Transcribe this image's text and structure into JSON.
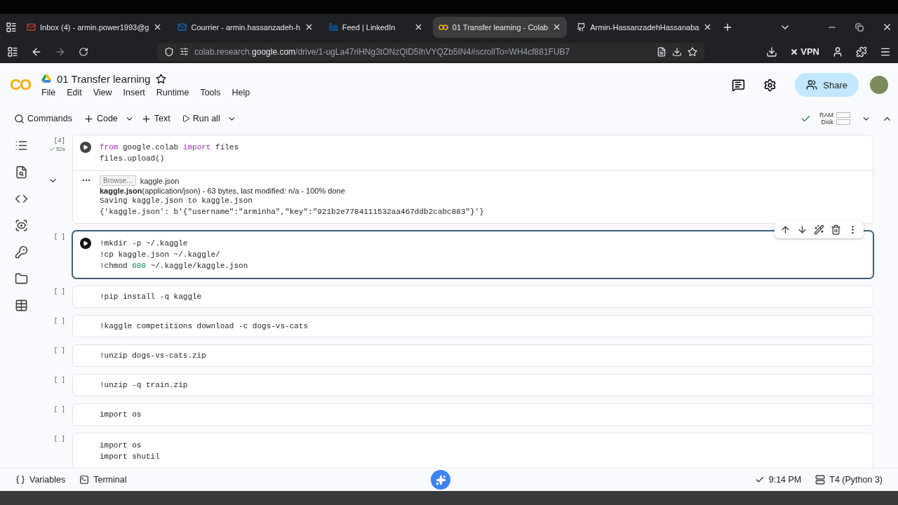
{
  "browser": {
    "tabs": [
      {
        "title": "Inbox (4) - armin.power1993@g",
        "selected": false
      },
      {
        "title": "Courrier - armin.hassanzadeh-h",
        "selected": false
      },
      {
        "title": "Feed | LinkedIn",
        "selected": false
      },
      {
        "title": "01 Transfer learning - Colab",
        "selected": true
      },
      {
        "title": "Armin-HassanzadehHassanaba",
        "selected": false
      }
    ],
    "url": {
      "host_prefix": "colab.research.",
      "domain": "google.com",
      "path": "/drive/1-ugLa47riHNg3tONzQlD5IhVYQZb5IN4#scrollTo=WH4cf881FUB7"
    },
    "vpn": "VPN"
  },
  "notebook": {
    "logo": "CO",
    "title": "01 Transfer learning",
    "menus": [
      "File",
      "Edit",
      "View",
      "Insert",
      "Runtime",
      "Tools",
      "Help"
    ],
    "share": "Share",
    "toolbar": {
      "commands": "Commands",
      "code": "Code",
      "text": "Text",
      "run_all": "Run all",
      "ram": "RAM",
      "disk": "Disk"
    }
  },
  "cells": [
    {
      "label": "[4]",
      "duration": "52s",
      "focused": false,
      "lines": [
        [
          {
            "text": "from",
            "kind": "keyword"
          },
          {
            "text": " google.colab ",
            "kind": "plain"
          },
          {
            "text": "import",
            "kind": "keyword"
          },
          {
            "text": " files",
            "kind": "plain"
          }
        ],
        [
          {
            "text": "files.upload()",
            "kind": "plain"
          }
        ]
      ],
      "output": {
        "browse": "Browse...",
        "file": "kaggle.json",
        "status": "**kaggle.json**(application/json) - 63 bytes, last modified: n/a - 100% done",
        "lines": [
          "Saving kaggle.json to kaggle.json",
          "{'kaggle.json': b'{\"username\":\"arminha\",\"key\":\"921b2e7784111532aa467ddb2cabc883\"}'}"
        ]
      }
    },
    {
      "label": "[ ]",
      "focused": true,
      "lines": [
        [
          {
            "text": "!mkdir -p ~/.kaggle",
            "kind": "plain"
          }
        ],
        [
          {
            "text": "!cp kaggle.json ~/.kaggle/",
            "kind": "plain"
          }
        ],
        [
          {
            "text": "!chmod ",
            "kind": "plain"
          },
          {
            "text": "600",
            "kind": "number"
          },
          {
            "text": " ~/.kaggle/kaggle.json",
            "kind": "plain"
          }
        ]
      ]
    },
    {
      "label": "[ ]",
      "focused": false,
      "lines": [
        [
          {
            "text": "!pip install -q kaggle",
            "kind": "plain"
          }
        ]
      ]
    },
    {
      "label": "[ ]",
      "focused": false,
      "lines": [
        [
          {
            "text": "!kaggle competitions download -c dogs-vs-cats",
            "kind": "plain"
          }
        ]
      ]
    },
    {
      "label": "[ ]",
      "focused": false,
      "lines": [
        [
          {
            "text": "!unzip dogs-vs-cats.zip",
            "kind": "plain"
          }
        ]
      ]
    },
    {
      "label": "[ ]",
      "focused": false,
      "lines": [
        [
          {
            "text": "!unzip -q train.zip",
            "kind": "plain"
          }
        ]
      ]
    },
    {
      "label": "[ ]",
      "focused": false,
      "lines": [
        [
          {
            "text": "import",
            "kind": "plain"
          },
          {
            "text": " os",
            "kind": "plain"
          }
        ]
      ]
    },
    {
      "label": "[ ]",
      "focused": false,
      "lines": [
        [
          {
            "text": "import",
            "kind": "plain"
          },
          {
            "text": " os",
            "kind": "plain"
          }
        ],
        [
          {
            "text": "import",
            "kind": "plain"
          },
          {
            "text": " shutil",
            "kind": "plain"
          }
        ]
      ]
    }
  ],
  "status_bar": {
    "variables": "Variables",
    "terminal": "Terminal",
    "time": "9:14 PM",
    "runtime": "T4 (Python 3)"
  }
}
